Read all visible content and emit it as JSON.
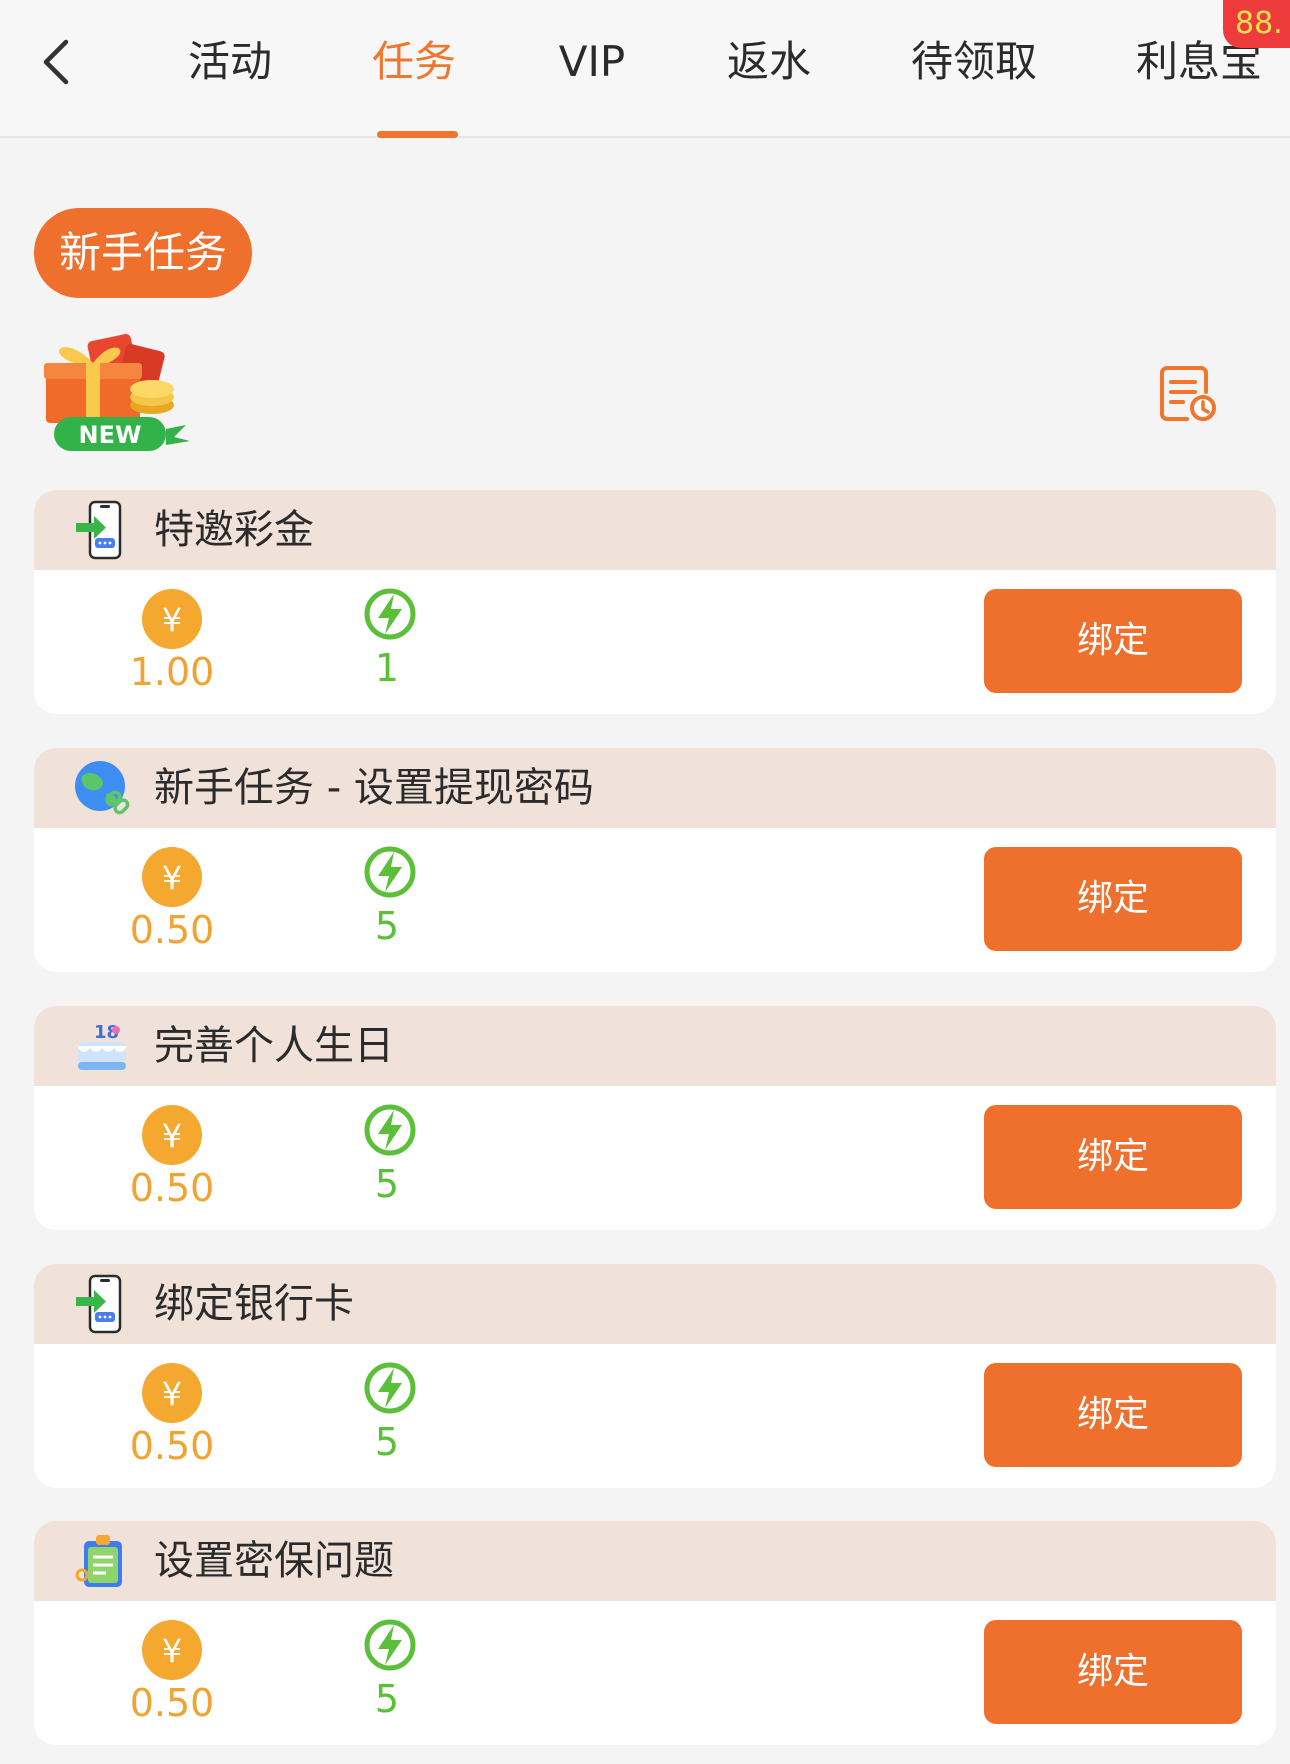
{
  "nav": {
    "tabs": [
      {
        "label": "活动"
      },
      {
        "label": "任务"
      },
      {
        "label": "VIP"
      },
      {
        "label": "返水"
      },
      {
        "label": "待领取"
      },
      {
        "label": "利息宝"
      }
    ],
    "active_tab": "任务",
    "badge": "88."
  },
  "section": {
    "title": "新手任务",
    "banner_icon": "new-gift-icon"
  },
  "tasks": [
    {
      "title": "特邀彩金",
      "icon": "phone-login-icon",
      "reward": "1.00",
      "energy": "1",
      "button": "绑定"
    },
    {
      "title": "新手任务 - 设置提现密码",
      "icon": "globe-link-icon",
      "reward": "0.50",
      "energy": "5",
      "button": "绑定"
    },
    {
      "title": "完善个人生日",
      "icon": "birthday-cake-icon",
      "reward": "0.50",
      "energy": "5",
      "button": "绑定"
    },
    {
      "title": "绑定银行卡",
      "icon": "phone-login-icon",
      "reward": "0.50",
      "energy": "5",
      "button": "绑定"
    },
    {
      "title": "设置密保问题",
      "icon": "security-clipboard-icon",
      "reward": "0.50",
      "energy": "5",
      "button": "绑定"
    }
  ],
  "colors": {
    "accent": "#ef6f2c",
    "reward": "#f0a332",
    "energy": "#5cbf3a",
    "card_header": "#f1e2d9",
    "badge": "#ee3b3b"
  }
}
